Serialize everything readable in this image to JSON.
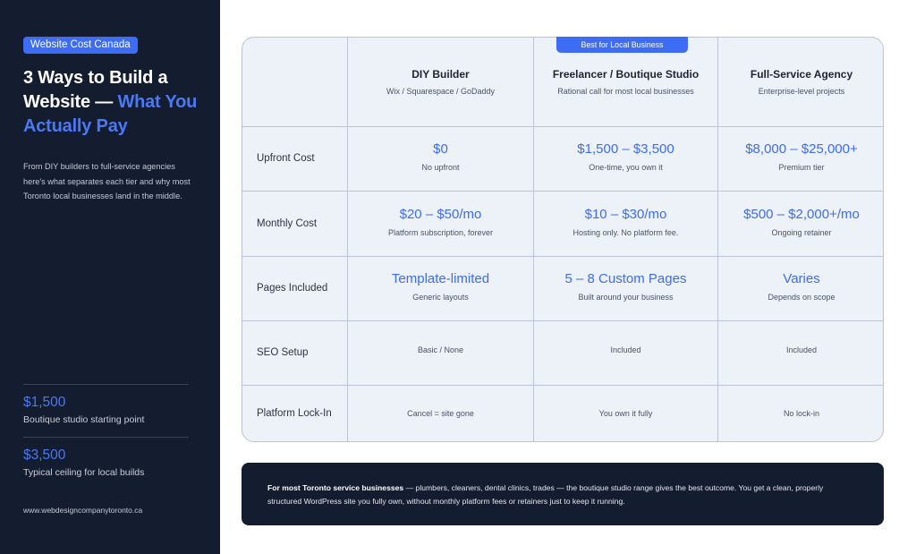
{
  "sidebar": {
    "badge": "Website Cost Canada",
    "headline_white": "3 Ways to Build a Website — ",
    "headline_blue": "What You Actually Pay",
    "intro": "From DIY builders to full-service agencies here's what separates each tier and why most Toronto local businesses land in the middle.",
    "stats": [
      {
        "value": "$1,500",
        "label": "Boutique studio starting point"
      },
      {
        "value": "$3,500",
        "label": "Typical ceiling for local builds"
      }
    ],
    "url": "www.webdesigncompanytoronto.ca"
  },
  "table": {
    "highlight_tag": "Best for Local Business",
    "columns": [
      {
        "title": "DIY Builder",
        "subtitle": "Wix / Squarespace / GoDaddy"
      },
      {
        "title": "Freelancer / Boutique Studio",
        "subtitle": "Rational call for most local businesses"
      },
      {
        "title": "Full-Service Agency",
        "subtitle": "Enterprise-level projects"
      }
    ],
    "rows": [
      {
        "label": "Upfront Cost",
        "cells": [
          {
            "value": "$0",
            "note": "No upfront"
          },
          {
            "value": "$1,500 – $3,500",
            "note": "One-time, you own it"
          },
          {
            "value": "$8,000 – $25,000+",
            "note": "Premium tier"
          }
        ]
      },
      {
        "label": "Monthly Cost",
        "cells": [
          {
            "value": "$20 – $50/mo",
            "note": "Platform subscription, forever"
          },
          {
            "value": "$10 – $30/mo",
            "note": "Hosting only. No platform fee."
          },
          {
            "value": "$500 – $2,000+/mo",
            "note": "Ongoing retainer"
          }
        ]
      },
      {
        "label": "Pages Included",
        "cells": [
          {
            "value": "Template-limited",
            "note": "Generic layouts"
          },
          {
            "value": "5 – 8 Custom Pages",
            "note": "Built around your business"
          },
          {
            "value": "Varies",
            "note": "Depends on scope"
          }
        ]
      },
      {
        "label": "SEO Setup",
        "cells": [
          {
            "text": "Basic / None"
          },
          {
            "text": "Included"
          },
          {
            "text": "Included"
          }
        ]
      },
      {
        "label": "Platform Lock-In",
        "cells": [
          {
            "text": "Cancel = site gone"
          },
          {
            "text": "You own it fully"
          },
          {
            "text": "No lock-in"
          }
        ]
      }
    ]
  },
  "note": {
    "lead": "For most Toronto service businesses",
    "body": " — plumbers, cleaners, dental clinics, trades — the boutique studio range gives the best outcome. You get a clean, properly structured WordPress site you fully own, without monthly platform fees or retainers just to keep it running."
  },
  "colors": {
    "sidebar_bg": "#141c2f",
    "accent": "#3d6cf5",
    "table_bg": "#edf1f8",
    "border": "#bcc4d2"
  }
}
